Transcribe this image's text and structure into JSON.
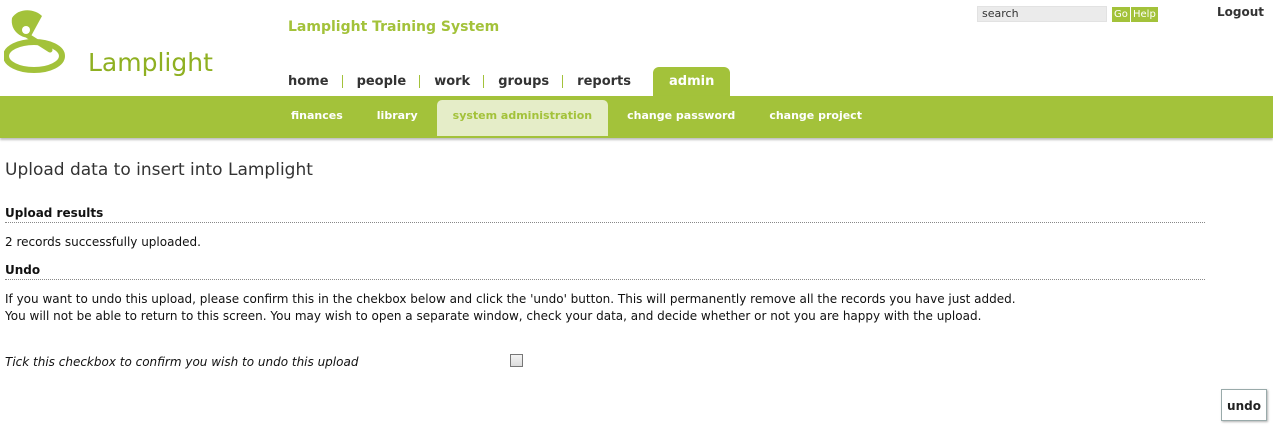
{
  "brand": {
    "logo_text": "Lamplight",
    "system_title": "Lamplight Training System",
    "accent": "#a3c23a"
  },
  "header": {
    "search_value": "search",
    "go_label": "Go",
    "help_label": "Help",
    "logout_label": "Logout"
  },
  "nav": {
    "tabs": [
      {
        "label": "home"
      },
      {
        "label": "people"
      },
      {
        "label": "work"
      },
      {
        "label": "groups"
      },
      {
        "label": "reports"
      },
      {
        "label": "admin"
      }
    ],
    "active_tab": "admin",
    "sub_items": [
      {
        "label": "finances"
      },
      {
        "label": "library"
      },
      {
        "label": "system administration"
      },
      {
        "label": "change password"
      },
      {
        "label": "change project"
      }
    ],
    "active_sub": "system administration"
  },
  "main": {
    "page_title": "Upload data to insert into Lamplight",
    "results_heading": "Upload results",
    "results_text": "2 records successfully uploaded.",
    "undo_heading": "Undo",
    "undo_line1": "If you want to undo this upload, please confirm this in the chekbox below and click the 'undo' button. This will permanently remove all the records you have just added.",
    "undo_line2": "You will not be able to return to this screen. You may wish to open a separate window, check your data, and decide whether or not you are happy with the upload.",
    "confirm_label": "Tick this checkbox to confirm you wish to undo this upload",
    "confirm_checked": false,
    "undo_button": "undo"
  }
}
